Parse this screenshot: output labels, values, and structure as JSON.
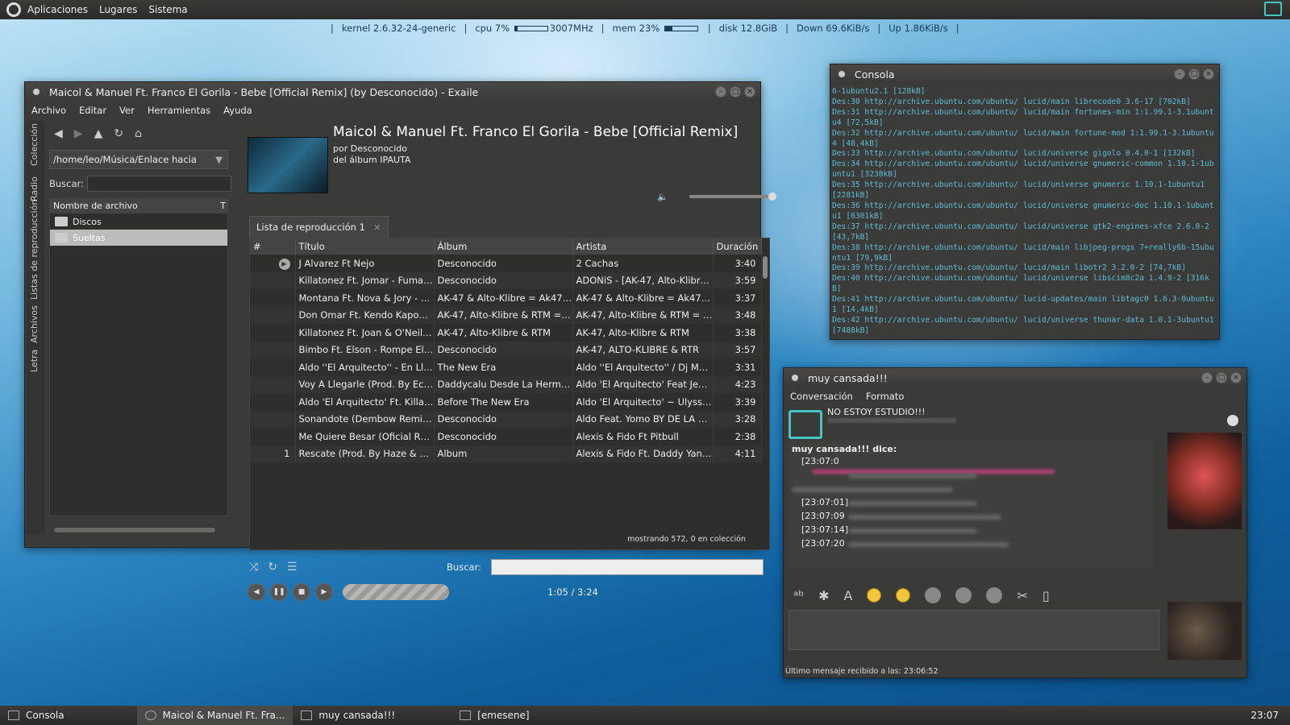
{
  "top_panel": {
    "menus": [
      "Aplicaciones",
      "Lugares",
      "Sistema"
    ]
  },
  "conky": {
    "kernel": "kernel 2.6.32-24-generic",
    "cpu_label": "cpu 7%",
    "cpu_pct": 7,
    "cpu_freq": "3007MHz",
    "mem_label": "mem 23%",
    "mem_pct": 23,
    "disk": "disk 12.8GiB",
    "down": "Down 69.6KiB/s",
    "up": "Up 1.86KiB/s"
  },
  "exaile": {
    "title": "Maicol & Manuel Ft. Franco El Gorila - Bebe [Official Remix] (by Desconocido) - Exaile",
    "menus": [
      "Archivo",
      "Editar",
      "Ver",
      "Herramientas",
      "Ayuda"
    ],
    "side_tabs": [
      "Colección",
      "Radio",
      "Listas de reproducción",
      "Archivos",
      "Letra"
    ],
    "path": "/home/leo/Música/Enlace hacia",
    "search_label": "Buscar:",
    "file_header": "Nombre de archivo",
    "file_header_t": "T",
    "files": [
      "Discos",
      "Sueltas"
    ],
    "now_playing": {
      "title": "Maicol & Manuel Ft. Franco El Gorila - Bebe [Official Remix]",
      "by": "por Desconocido",
      "album": "del álbum IPAUTA"
    },
    "playlist_tab": "Lista de reproducción 1",
    "columns": [
      "#",
      "Título",
      "Álbum",
      "Artista",
      "Duración"
    ],
    "rows": [
      [
        "",
        "J Alvarez Ft Nejo",
        "Desconocido",
        "2 Cachas",
        "3:40"
      ],
      [
        "",
        "Killatonez Ft. Jomar - Fumar (...",
        "Desconocido",
        "ADONiS - [AK-47, Alto-Klibre ...",
        "3:59"
      ],
      [
        "",
        "Montana Ft. Nova & Jory - Co...",
        "AK-47 & Alto-Klibre = Ak47M...",
        "AK-47 & Alto-Klibre = Ak47Mu...",
        "3:37"
      ],
      [
        "",
        "Don Omar Ft. Kendo Kaponi - ...",
        "AK-47, Alto-Klibre & RTM = Th...",
        "AK-47, Alto-Klibre & RTM = Th...",
        "3:48"
      ],
      [
        "",
        "Killatonez Ft. Joan & O'Neill - ...",
        "AK-47, Alto-Klibre & RTM",
        "AK-47, Alto-Klibre & RTM",
        "3:38"
      ],
      [
        "",
        "Bimbo Ft. Elson - Rompe El Su...",
        "Desconocido",
        "AK-47, ALTO-KLIBRE & RTR",
        "3:57"
      ],
      [
        "",
        "Aldo ''El Arquitecto'' - En Lla...",
        "The New Era",
        "Aldo ''El Arquitecto'' / Dj Mem...",
        "3:31"
      ],
      [
        "",
        "Voy A Llegarle (Prod. By Ecko)",
        "Daddycalu Desde La Hermand...",
        "Aldo 'El Arquitecto' Feat Jena...",
        "4:23"
      ],
      [
        "",
        "Aldo 'El Arquitecto' Ft. Killato...",
        "Before The New Era",
        "Aldo 'El Arquitecto' ~ Ulysses [...",
        "3:39"
      ],
      [
        "",
        "Sonandote (Dembow Remix) ...",
        "Desconocido",
        "Aldo Feat. Yomo BY DE LA GE...",
        "3:28"
      ],
      [
        "",
        "Me Quiere Besar (Oficial Rmx)",
        "Desconocido",
        "Alexis & Fido Ft Pitbull",
        "2:38"
      ],
      [
        "1",
        "Rescate (Prod. By Haze & Mast...",
        "Album",
        "Alexis & Fido Ft. Daddy Yankee",
        "4:11"
      ]
    ],
    "search2_label": "Buscar:",
    "time": "1:05 / 3:24",
    "seek_fraction": 0.33,
    "volume_fraction": 0.9,
    "status": "mostrando 572, 0 en colección"
  },
  "consola": {
    "title": "Consola",
    "lines": "6-1ubuntu2.1 [128kB]\nDes:30 http://archive.ubuntu.com/ubuntu/ lucid/main librecode0 3.6-17 [702kB]\nDes:31 http://archive.ubuntu.com/ubuntu/ lucid/main fortunes-min 1:1.99.1-3.1ubuntu4 [72,5kB]\nDes:32 http://archive.ubuntu.com/ubuntu/ lucid/main fortune-mod 1:1.99.1-3.1ubuntu4 [48,4kB]\nDes:33 http://archive.ubuntu.com/ubuntu/ lucid/universe gigolo 0.4.0-1 [132kB]\nDes:34 http://archive.ubuntu.com/ubuntu/ lucid/universe gnumeric-common 1.10.1-1ubuntu1 [3238kB]\nDes:35 http://archive.ubuntu.com/ubuntu/ lucid/universe gnumeric 1.10.1-1ubuntu1 [2281kB]\nDes:36 http://archive.ubuntu.com/ubuntu/ lucid/universe gnumeric-doc 1.10.1-1ubuntu1 [6301kB]\nDes:37 http://archive.ubuntu.com/ubuntu/ lucid/universe gtk2-engines-xfce 2.6.0-2 [43,7kB]\nDes:38 http://archive.ubuntu.com/ubuntu/ lucid/main libjpeg-progs 7+really6b-15ubuntu1 [79,9kB]\nDes:39 http://archive.ubuntu.com/ubuntu/ lucid/main libotr2 3.2.0-2 [74,7kB]\nDes:40 http://archive.ubuntu.com/ubuntu/ lucid/universe libscim8c2a 1.4.9-2 [316kB]\nDes:41 http://archive.ubuntu.com/ubuntu/ lucid-updates/main libtagc0 1.6.3-0ubuntu1 [14,4kB]\nDes:42 http://archive.ubuntu.com/ubuntu/ lucid/universe thunar-data 1.0.1-3ubuntu1 [7488kB]"
  },
  "chat": {
    "title": "muy cansada!!!",
    "menus": [
      "Conversación",
      "Formato"
    ],
    "status": "NO ESTOY ESTUDIO!!!",
    "who": "muy cansada!!! dice:",
    "lines": [
      "[23:07:0",
      "",
      "",
      "[23:07:01]",
      "[23:07:09",
      "[23:07:14]",
      "[23:07:20"
    ],
    "footer": "Último mensaje recibido a las: 23:06:52"
  },
  "taskbar": {
    "items": [
      "Consola",
      "Maicol & Manuel Ft. Fra...",
      "muy cansada!!!",
      "[emesene]"
    ],
    "clock": "23:07"
  }
}
